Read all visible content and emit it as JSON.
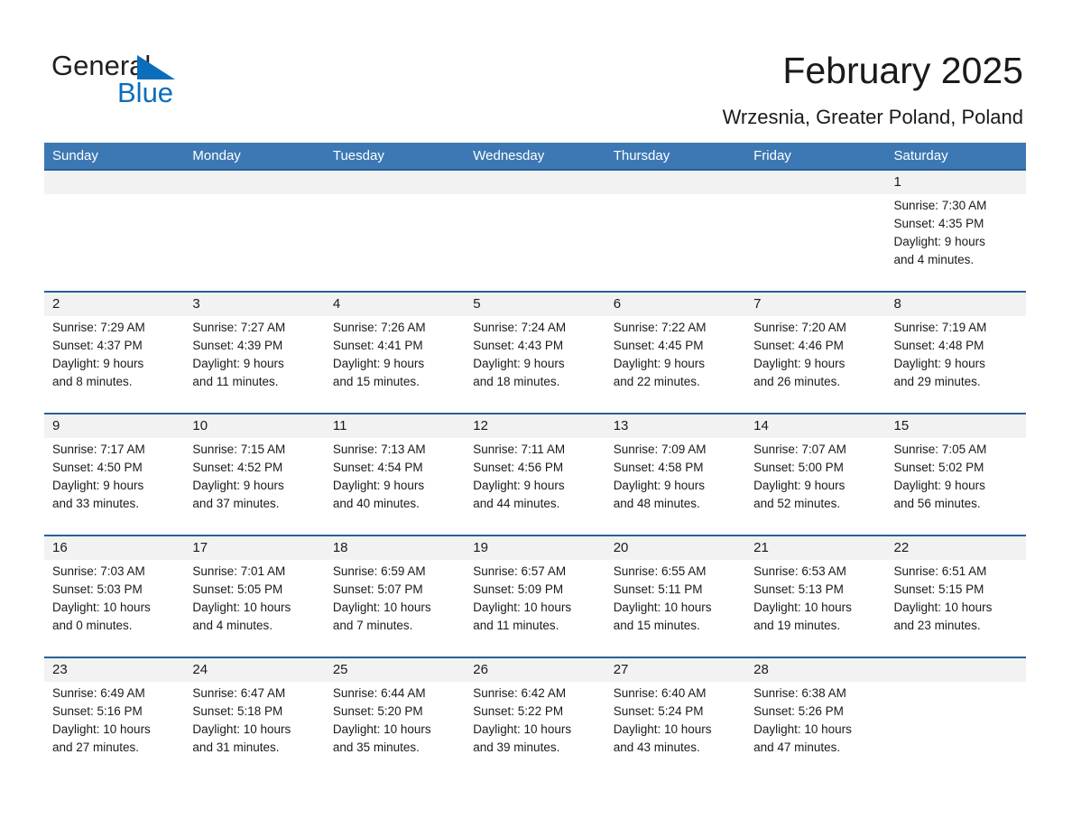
{
  "brand": {
    "name_part1": "General",
    "name_part2": "Blue",
    "triangle_color": "#0a6ebd",
    "text_color": "#231f20"
  },
  "header": {
    "title": "February 2025",
    "subtitle": "Wrzesnia, Greater Poland, Poland"
  },
  "colors": {
    "header_row_bg": "#3c78b4",
    "header_row_text": "#ffffff",
    "week_separator": "#2a6099",
    "daynum_band": "#f2f2f2",
    "body_text": "#1a1a1a"
  },
  "weekdays": [
    "Sunday",
    "Monday",
    "Tuesday",
    "Wednesday",
    "Thursday",
    "Friday",
    "Saturday"
  ],
  "weeks": [
    [
      {
        "day": "",
        "sunrise": "",
        "sunset": "",
        "daylight1": "",
        "daylight2": ""
      },
      {
        "day": "",
        "sunrise": "",
        "sunset": "",
        "daylight1": "",
        "daylight2": ""
      },
      {
        "day": "",
        "sunrise": "",
        "sunset": "",
        "daylight1": "",
        "daylight2": ""
      },
      {
        "day": "",
        "sunrise": "",
        "sunset": "",
        "daylight1": "",
        "daylight2": ""
      },
      {
        "day": "",
        "sunrise": "",
        "sunset": "",
        "daylight1": "",
        "daylight2": ""
      },
      {
        "day": "",
        "sunrise": "",
        "sunset": "",
        "daylight1": "",
        "daylight2": ""
      },
      {
        "day": "1",
        "sunrise": "Sunrise: 7:30 AM",
        "sunset": "Sunset: 4:35 PM",
        "daylight1": "Daylight: 9 hours",
        "daylight2": "and 4 minutes."
      }
    ],
    [
      {
        "day": "2",
        "sunrise": "Sunrise: 7:29 AM",
        "sunset": "Sunset: 4:37 PM",
        "daylight1": "Daylight: 9 hours",
        "daylight2": "and 8 minutes."
      },
      {
        "day": "3",
        "sunrise": "Sunrise: 7:27 AM",
        "sunset": "Sunset: 4:39 PM",
        "daylight1": "Daylight: 9 hours",
        "daylight2": "and 11 minutes."
      },
      {
        "day": "4",
        "sunrise": "Sunrise: 7:26 AM",
        "sunset": "Sunset: 4:41 PM",
        "daylight1": "Daylight: 9 hours",
        "daylight2": "and 15 minutes."
      },
      {
        "day": "5",
        "sunrise": "Sunrise: 7:24 AM",
        "sunset": "Sunset: 4:43 PM",
        "daylight1": "Daylight: 9 hours",
        "daylight2": "and 18 minutes."
      },
      {
        "day": "6",
        "sunrise": "Sunrise: 7:22 AM",
        "sunset": "Sunset: 4:45 PM",
        "daylight1": "Daylight: 9 hours",
        "daylight2": "and 22 minutes."
      },
      {
        "day": "7",
        "sunrise": "Sunrise: 7:20 AM",
        "sunset": "Sunset: 4:46 PM",
        "daylight1": "Daylight: 9 hours",
        "daylight2": "and 26 minutes."
      },
      {
        "day": "8",
        "sunrise": "Sunrise: 7:19 AM",
        "sunset": "Sunset: 4:48 PM",
        "daylight1": "Daylight: 9 hours",
        "daylight2": "and 29 minutes."
      }
    ],
    [
      {
        "day": "9",
        "sunrise": "Sunrise: 7:17 AM",
        "sunset": "Sunset: 4:50 PM",
        "daylight1": "Daylight: 9 hours",
        "daylight2": "and 33 minutes."
      },
      {
        "day": "10",
        "sunrise": "Sunrise: 7:15 AM",
        "sunset": "Sunset: 4:52 PM",
        "daylight1": "Daylight: 9 hours",
        "daylight2": "and 37 minutes."
      },
      {
        "day": "11",
        "sunrise": "Sunrise: 7:13 AM",
        "sunset": "Sunset: 4:54 PM",
        "daylight1": "Daylight: 9 hours",
        "daylight2": "and 40 minutes."
      },
      {
        "day": "12",
        "sunrise": "Sunrise: 7:11 AM",
        "sunset": "Sunset: 4:56 PM",
        "daylight1": "Daylight: 9 hours",
        "daylight2": "and 44 minutes."
      },
      {
        "day": "13",
        "sunrise": "Sunrise: 7:09 AM",
        "sunset": "Sunset: 4:58 PM",
        "daylight1": "Daylight: 9 hours",
        "daylight2": "and 48 minutes."
      },
      {
        "day": "14",
        "sunrise": "Sunrise: 7:07 AM",
        "sunset": "Sunset: 5:00 PM",
        "daylight1": "Daylight: 9 hours",
        "daylight2": "and 52 minutes."
      },
      {
        "day": "15",
        "sunrise": "Sunrise: 7:05 AM",
        "sunset": "Sunset: 5:02 PM",
        "daylight1": "Daylight: 9 hours",
        "daylight2": "and 56 minutes."
      }
    ],
    [
      {
        "day": "16",
        "sunrise": "Sunrise: 7:03 AM",
        "sunset": "Sunset: 5:03 PM",
        "daylight1": "Daylight: 10 hours",
        "daylight2": "and 0 minutes."
      },
      {
        "day": "17",
        "sunrise": "Sunrise: 7:01 AM",
        "sunset": "Sunset: 5:05 PM",
        "daylight1": "Daylight: 10 hours",
        "daylight2": "and 4 minutes."
      },
      {
        "day": "18",
        "sunrise": "Sunrise: 6:59 AM",
        "sunset": "Sunset: 5:07 PM",
        "daylight1": "Daylight: 10 hours",
        "daylight2": "and 7 minutes."
      },
      {
        "day": "19",
        "sunrise": "Sunrise: 6:57 AM",
        "sunset": "Sunset: 5:09 PM",
        "daylight1": "Daylight: 10 hours",
        "daylight2": "and 11 minutes."
      },
      {
        "day": "20",
        "sunrise": "Sunrise: 6:55 AM",
        "sunset": "Sunset: 5:11 PM",
        "daylight1": "Daylight: 10 hours",
        "daylight2": "and 15 minutes."
      },
      {
        "day": "21",
        "sunrise": "Sunrise: 6:53 AM",
        "sunset": "Sunset: 5:13 PM",
        "daylight1": "Daylight: 10 hours",
        "daylight2": "and 19 minutes."
      },
      {
        "day": "22",
        "sunrise": "Sunrise: 6:51 AM",
        "sunset": "Sunset: 5:15 PM",
        "daylight1": "Daylight: 10 hours",
        "daylight2": "and 23 minutes."
      }
    ],
    [
      {
        "day": "23",
        "sunrise": "Sunrise: 6:49 AM",
        "sunset": "Sunset: 5:16 PM",
        "daylight1": "Daylight: 10 hours",
        "daylight2": "and 27 minutes."
      },
      {
        "day": "24",
        "sunrise": "Sunrise: 6:47 AM",
        "sunset": "Sunset: 5:18 PM",
        "daylight1": "Daylight: 10 hours",
        "daylight2": "and 31 minutes."
      },
      {
        "day": "25",
        "sunrise": "Sunrise: 6:44 AM",
        "sunset": "Sunset: 5:20 PM",
        "daylight1": "Daylight: 10 hours",
        "daylight2": "and 35 minutes."
      },
      {
        "day": "26",
        "sunrise": "Sunrise: 6:42 AM",
        "sunset": "Sunset: 5:22 PM",
        "daylight1": "Daylight: 10 hours",
        "daylight2": "and 39 minutes."
      },
      {
        "day": "27",
        "sunrise": "Sunrise: 6:40 AM",
        "sunset": "Sunset: 5:24 PM",
        "daylight1": "Daylight: 10 hours",
        "daylight2": "and 43 minutes."
      },
      {
        "day": "28",
        "sunrise": "Sunrise: 6:38 AM",
        "sunset": "Sunset: 5:26 PM",
        "daylight1": "Daylight: 10 hours",
        "daylight2": "and 47 minutes."
      },
      {
        "day": "",
        "sunrise": "",
        "sunset": "",
        "daylight1": "",
        "daylight2": ""
      }
    ]
  ]
}
